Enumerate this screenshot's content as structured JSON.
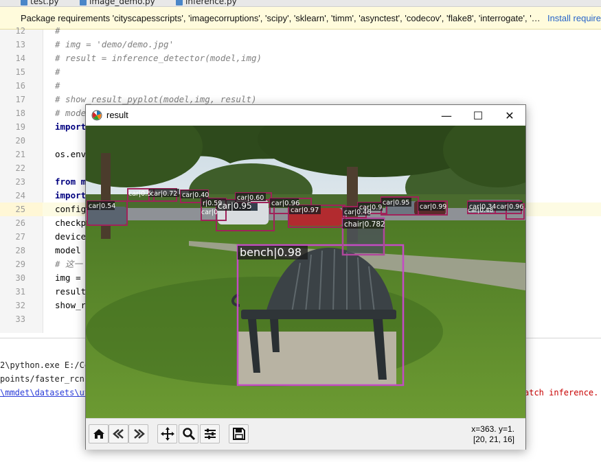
{
  "tabs": [
    "test.py",
    "image_demo.py",
    "inference.py"
  ],
  "banner": {
    "text": "Package requirements 'cityscapesscripts', 'imagecorruptions', 'scipy', 'sklearn', 'timm', 'asynctest', 'codecov', 'flake8', 'interrogate', '…",
    "link": "Install require"
  },
  "editor": {
    "line_numbers": [
      "12",
      "13",
      "14",
      "15",
      "16",
      "17",
      "18",
      "19",
      "20",
      "21",
      "22",
      "23",
      "24",
      "25",
      "26",
      "27",
      "28",
      "29",
      "30",
      "31",
      "32",
      "33"
    ],
    "lines": [
      "#",
      "# img = 'demo/demo.jpg'",
      "# result = inference_detector(model,img)",
      "#",
      "#",
      "# show_result_pyplot(model,img, result)",
      "# model",
      "import",
      "",
      "os.envi",
      "",
      "from mm",
      "import",
      "config_",
      "checkpo",
      "device",
      "model =",
      "# 这一",
      "img =",
      "result",
      "show_re",
      ""
    ]
  },
  "run_output": {
    "line1": "2\\python.exe E:/Co",
    "line2": "points/faster_rcnn",
    "line3_link": "\\mmdet\\datasets\\ut",
    "line3_tail": "atch inference."
  },
  "window": {
    "title": "result",
    "minimize": "—",
    "maximize": "☐",
    "close": "✕",
    "coords_line1": "x=363. y=1.",
    "coords_line2": "[20, 21, 16]"
  },
  "toolbar_icons": [
    "home-icon",
    "back-icon",
    "forward-icon",
    "pan-icon",
    "zoom-icon",
    "configure-icon",
    "save-icon"
  ],
  "detections": [
    {
      "label": "bench|0.98",
      "color": "#c44bc4"
    },
    {
      "label": "chair|0.782",
      "color": "#b0479c"
    },
    {
      "label": "car|0.95",
      "color": "#a0225a"
    },
    {
      "label": "car|0.97",
      "color": "#a0225a"
    },
    {
      "label": "car|0.96",
      "color": "#a0225a"
    },
    {
      "label": "car|0.60",
      "color": "#a0225a"
    },
    {
      "label": "car|0.54",
      "color": "#a0225a"
    },
    {
      "label": "car|0.99",
      "color": "#a0225a"
    },
    {
      "label": "car|0.95",
      "color": "#a0225a"
    },
    {
      "label": "car|0.46",
      "color": "#a0225a"
    },
    {
      "label": "car|0.9",
      "color": "#a0225a"
    },
    {
      "label": "car|0.34",
      "color": "#a0225a"
    },
    {
      "label": "car|0.96",
      "color": "#a0225a"
    },
    {
      "label": "car|0.48",
      "color": "#a0225a"
    },
    {
      "label": "car|0.72",
      "color": "#a0225a"
    },
    {
      "label": "car|0.40",
      "color": "#a0225a"
    },
    {
      "label": "r|0.59",
      "color": "#a0225a"
    },
    {
      "label": "car|0.5",
      "color": "#a0225a"
    },
    {
      "label": "car|0",
      "color": "#a0225a"
    }
  ]
}
